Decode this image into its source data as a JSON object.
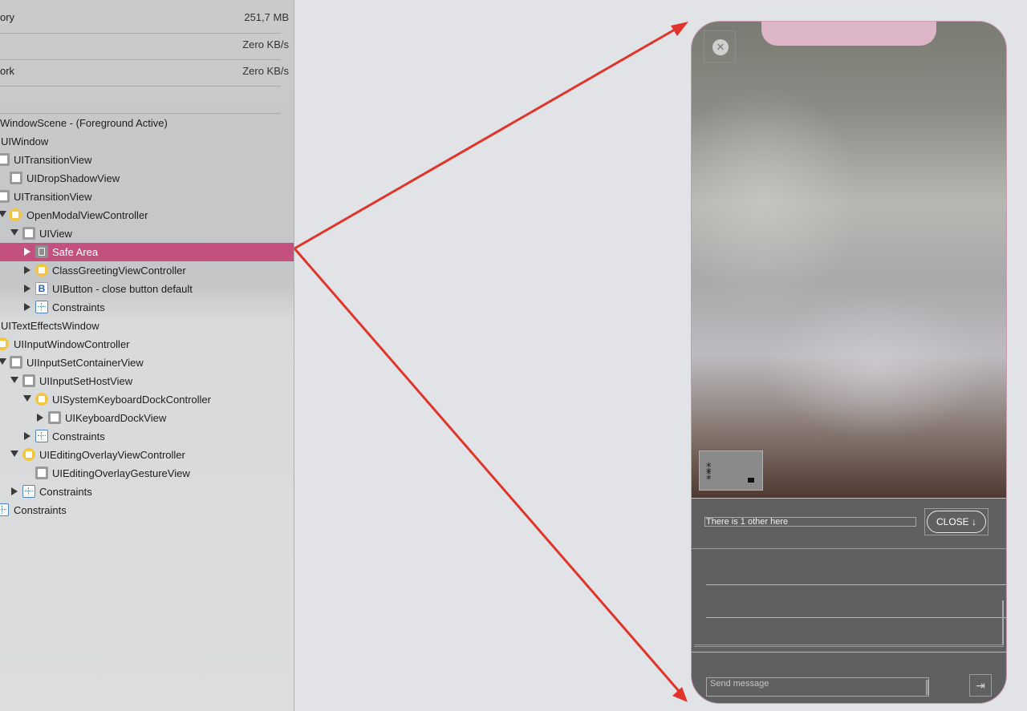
{
  "stats": [
    {
      "label": "ory",
      "value": "251,7 MB"
    },
    {
      "label": "",
      "value": "Zero KB/s"
    },
    {
      "label": "ork",
      "value": "Zero KB/s"
    }
  ],
  "tree": [
    {
      "label": "WindowScene - (Foreground Active)"
    },
    {
      "label": "UIWindow"
    },
    {
      "label": "UITransitionView"
    },
    {
      "label": "UIDropShadowView"
    },
    {
      "label": "UITransitionView"
    },
    {
      "label": "OpenModalViewController"
    },
    {
      "label": "UIView"
    },
    {
      "label": "Safe Area"
    },
    {
      "label": "ClassGreetingViewController"
    },
    {
      "label": "UIButton - close button default"
    },
    {
      "label": "Constraints"
    },
    {
      "label": "UITextEffectsWindow"
    },
    {
      "label": "UIInputWindowController"
    },
    {
      "label": "UIInputSetContainerView"
    },
    {
      "label": "UIInputSetHostView"
    },
    {
      "label": "UISystemKeyboardDockController"
    },
    {
      "label": "UIKeyboardDockView"
    },
    {
      "label": "Constraints"
    },
    {
      "label": "UIEditingOverlayViewController"
    },
    {
      "label": "UIEditingOverlayGestureView"
    },
    {
      "label": "Constraints"
    },
    {
      "label": "Constraints"
    }
  ],
  "selected_item": "Safe Area",
  "colors": {
    "selection": "#c3507f",
    "arrow": "#e0342b",
    "safe_area_outline": "#dcb6c7"
  },
  "phone": {
    "close_icon": "close-circle-icon",
    "info_text": "There is 1 other here",
    "close_button": "CLOSE ↓",
    "message_placeholder": "Send message",
    "send_icon": "send-arrow-icon",
    "send_glyph": "⇥"
  }
}
